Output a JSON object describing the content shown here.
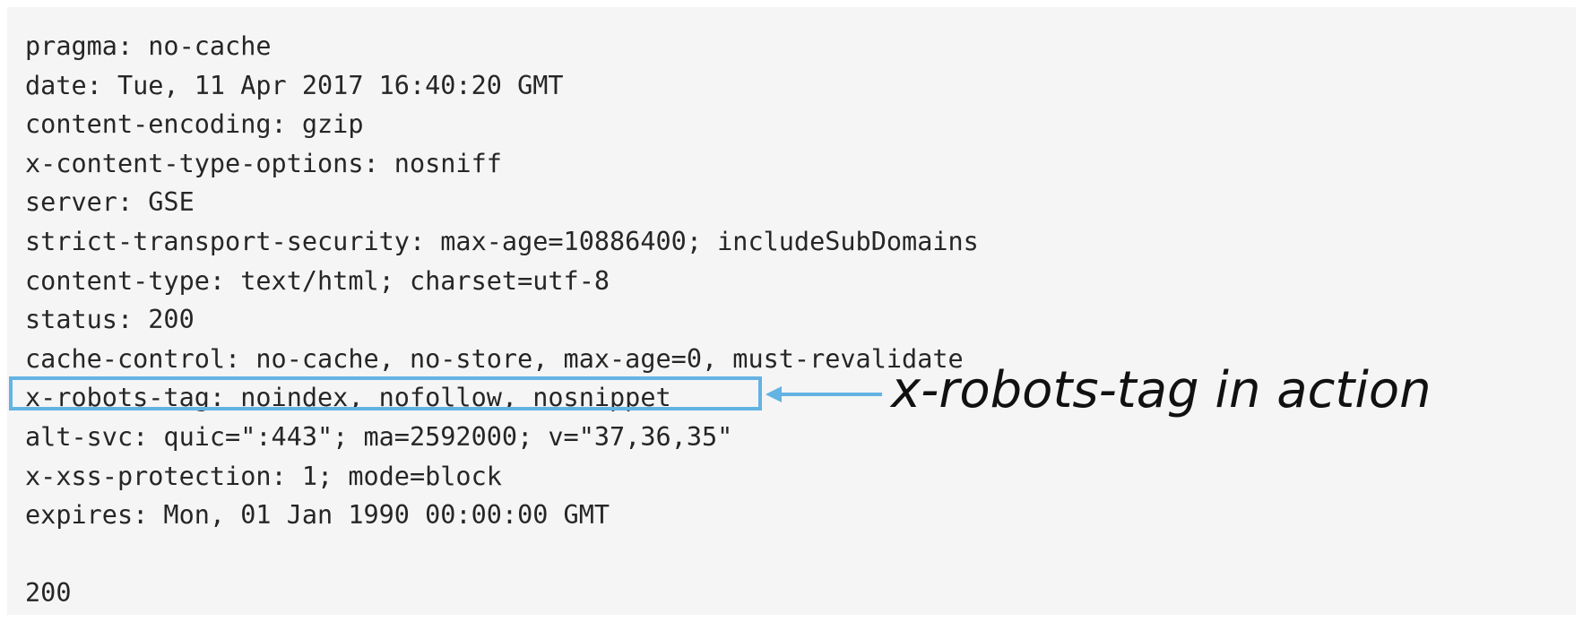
{
  "headers": [
    "pragma: no-cache",
    "date: Tue, 11 Apr 2017 16:40:20 GMT",
    "content-encoding: gzip",
    "x-content-type-options: nosniff",
    "server: GSE",
    "strict-transport-security: max-age=10886400; includeSubDomains",
    "content-type: text/html; charset=utf-8",
    "status: 200",
    "cache-control: no-cache, no-store, max-age=0, must-revalidate",
    "x-robots-tag: noindex, nofollow, nosnippet",
    "alt-svc: quic=\":443\"; ma=2592000; v=\"37,36,35\"",
    "x-xss-protection: 1; mode=block",
    "expires: Mon, 01 Jan 1990 00:00:00 GMT"
  ],
  "status_code": "200",
  "annotation": {
    "text": "x-robots-tag in action",
    "highlight_color": "#63b3e3"
  }
}
